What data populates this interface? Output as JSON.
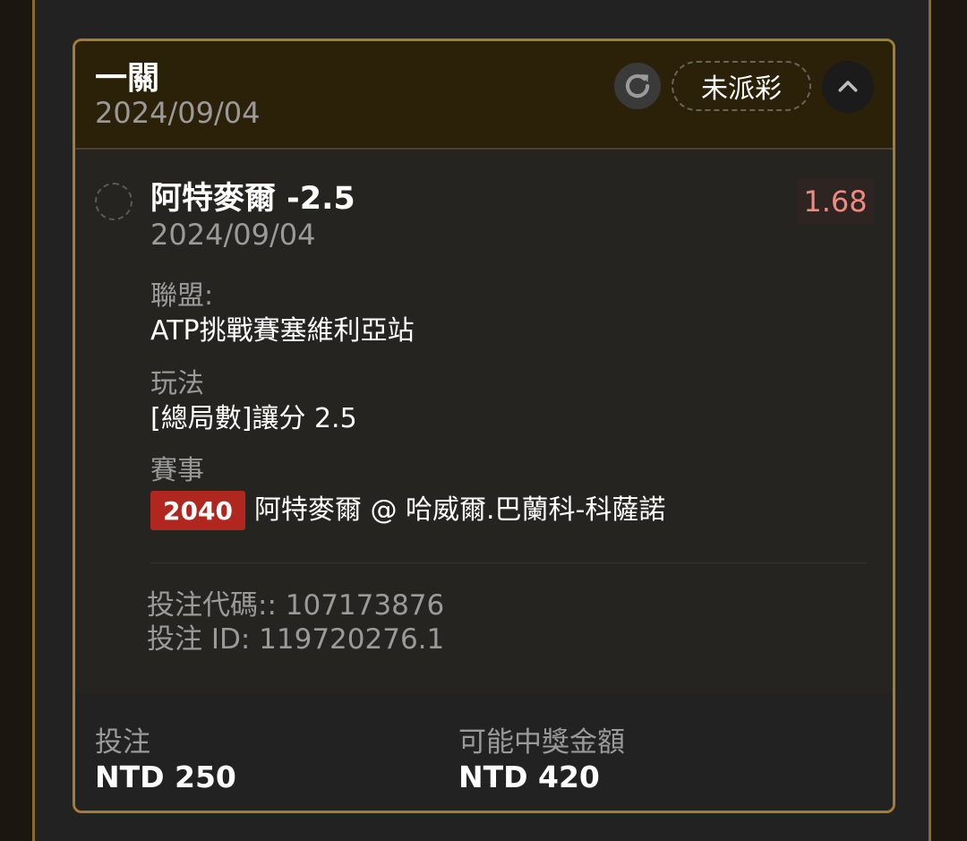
{
  "bet_card": {
    "title": "一關",
    "date": "2024/09/04",
    "status": "未派彩",
    "icons": {
      "refresh": "refresh-icon",
      "collapse": "chevron-up-icon",
      "select": "radio-circle-icon"
    },
    "colors": {
      "border": "#a27d33",
      "header_bg": "#2b2008",
      "odds": "#f08a7e",
      "event_code_bg": "#b1261f"
    }
  },
  "selection": {
    "name": "阿特麥爾 -2.5",
    "date": "2024/09/04",
    "odds": "1.68",
    "league_label": "聯盟:",
    "league_value": "ATP挑戰賽塞維利亞站",
    "bet_type_label": "玩法",
    "bet_type_value": "[總局數]讓分 2.5",
    "event_label": "賽事",
    "event_code": "2040",
    "event_name": "阿特麥爾 @ 哈威爾.巴蘭科-科薩諾"
  },
  "meta": {
    "bet_code": "投注代碼:: 107173876",
    "bet_id": "投注 ID: 119720276.1"
  },
  "footer": {
    "stake_label": "投注",
    "stake_value": "NTD 250",
    "payout_label": "可能中獎金額",
    "payout_value": "NTD 420"
  }
}
